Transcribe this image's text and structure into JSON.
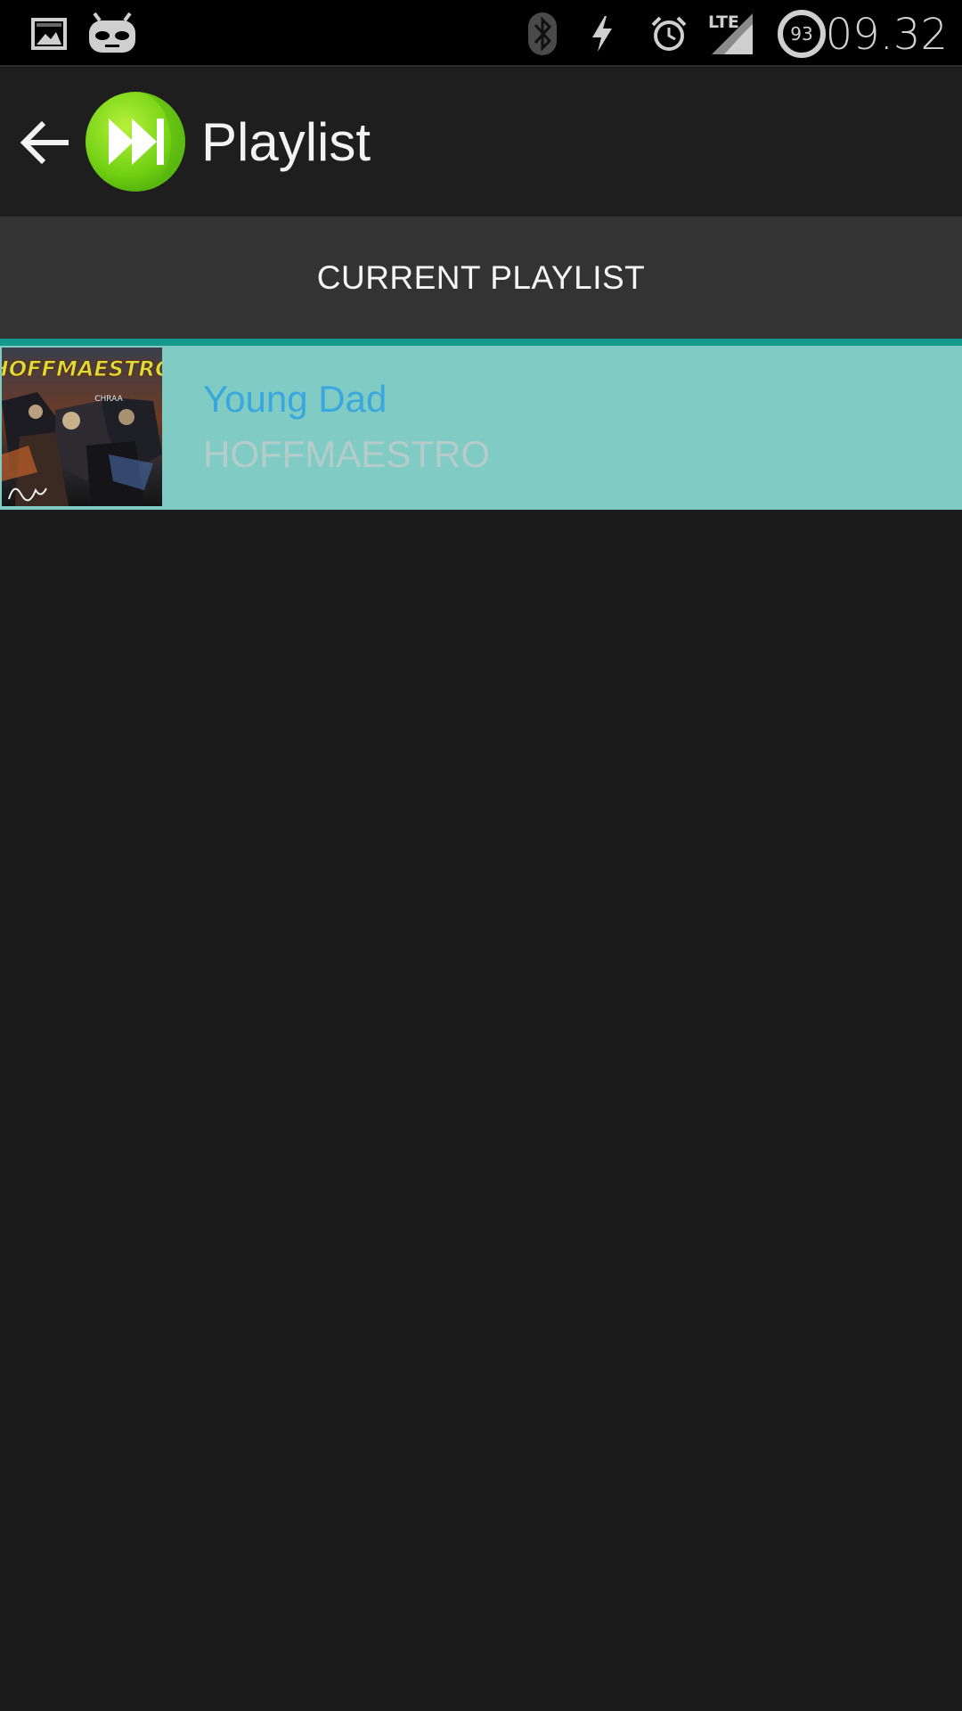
{
  "status_bar": {
    "time": "09.32",
    "battery_level": "93",
    "network_label": "LTE",
    "icons": [
      "gallery-notification-icon",
      "cyanogenmod-notification-icon",
      "bluetooth-icon",
      "charging-icon",
      "alarm-icon",
      "lte-signal-icon",
      "battery-icon"
    ]
  },
  "action_bar": {
    "title": "Playlist",
    "back_icon": "arrow-left-icon",
    "logo_icon": "fast-forward-icon"
  },
  "tabs": [
    {
      "label": "CURRENT PLAYLIST",
      "selected": true
    }
  ],
  "playlist": {
    "tracks": [
      {
        "title": "Young Dad",
        "artist": "HOFFMAESTRO",
        "album_art_text": "HOFFMAESTRO",
        "album_art_subtext": "CHRAA",
        "selected": true
      }
    ]
  },
  "colors": {
    "background": "#1b1b1b",
    "tab_background": "#333333",
    "tab_indicator": "#139a8c",
    "selected_row": "#80cbc4",
    "track_title": "#3aa7dd",
    "track_artist": "#b4cdca",
    "logo_green": "#7ed321"
  }
}
